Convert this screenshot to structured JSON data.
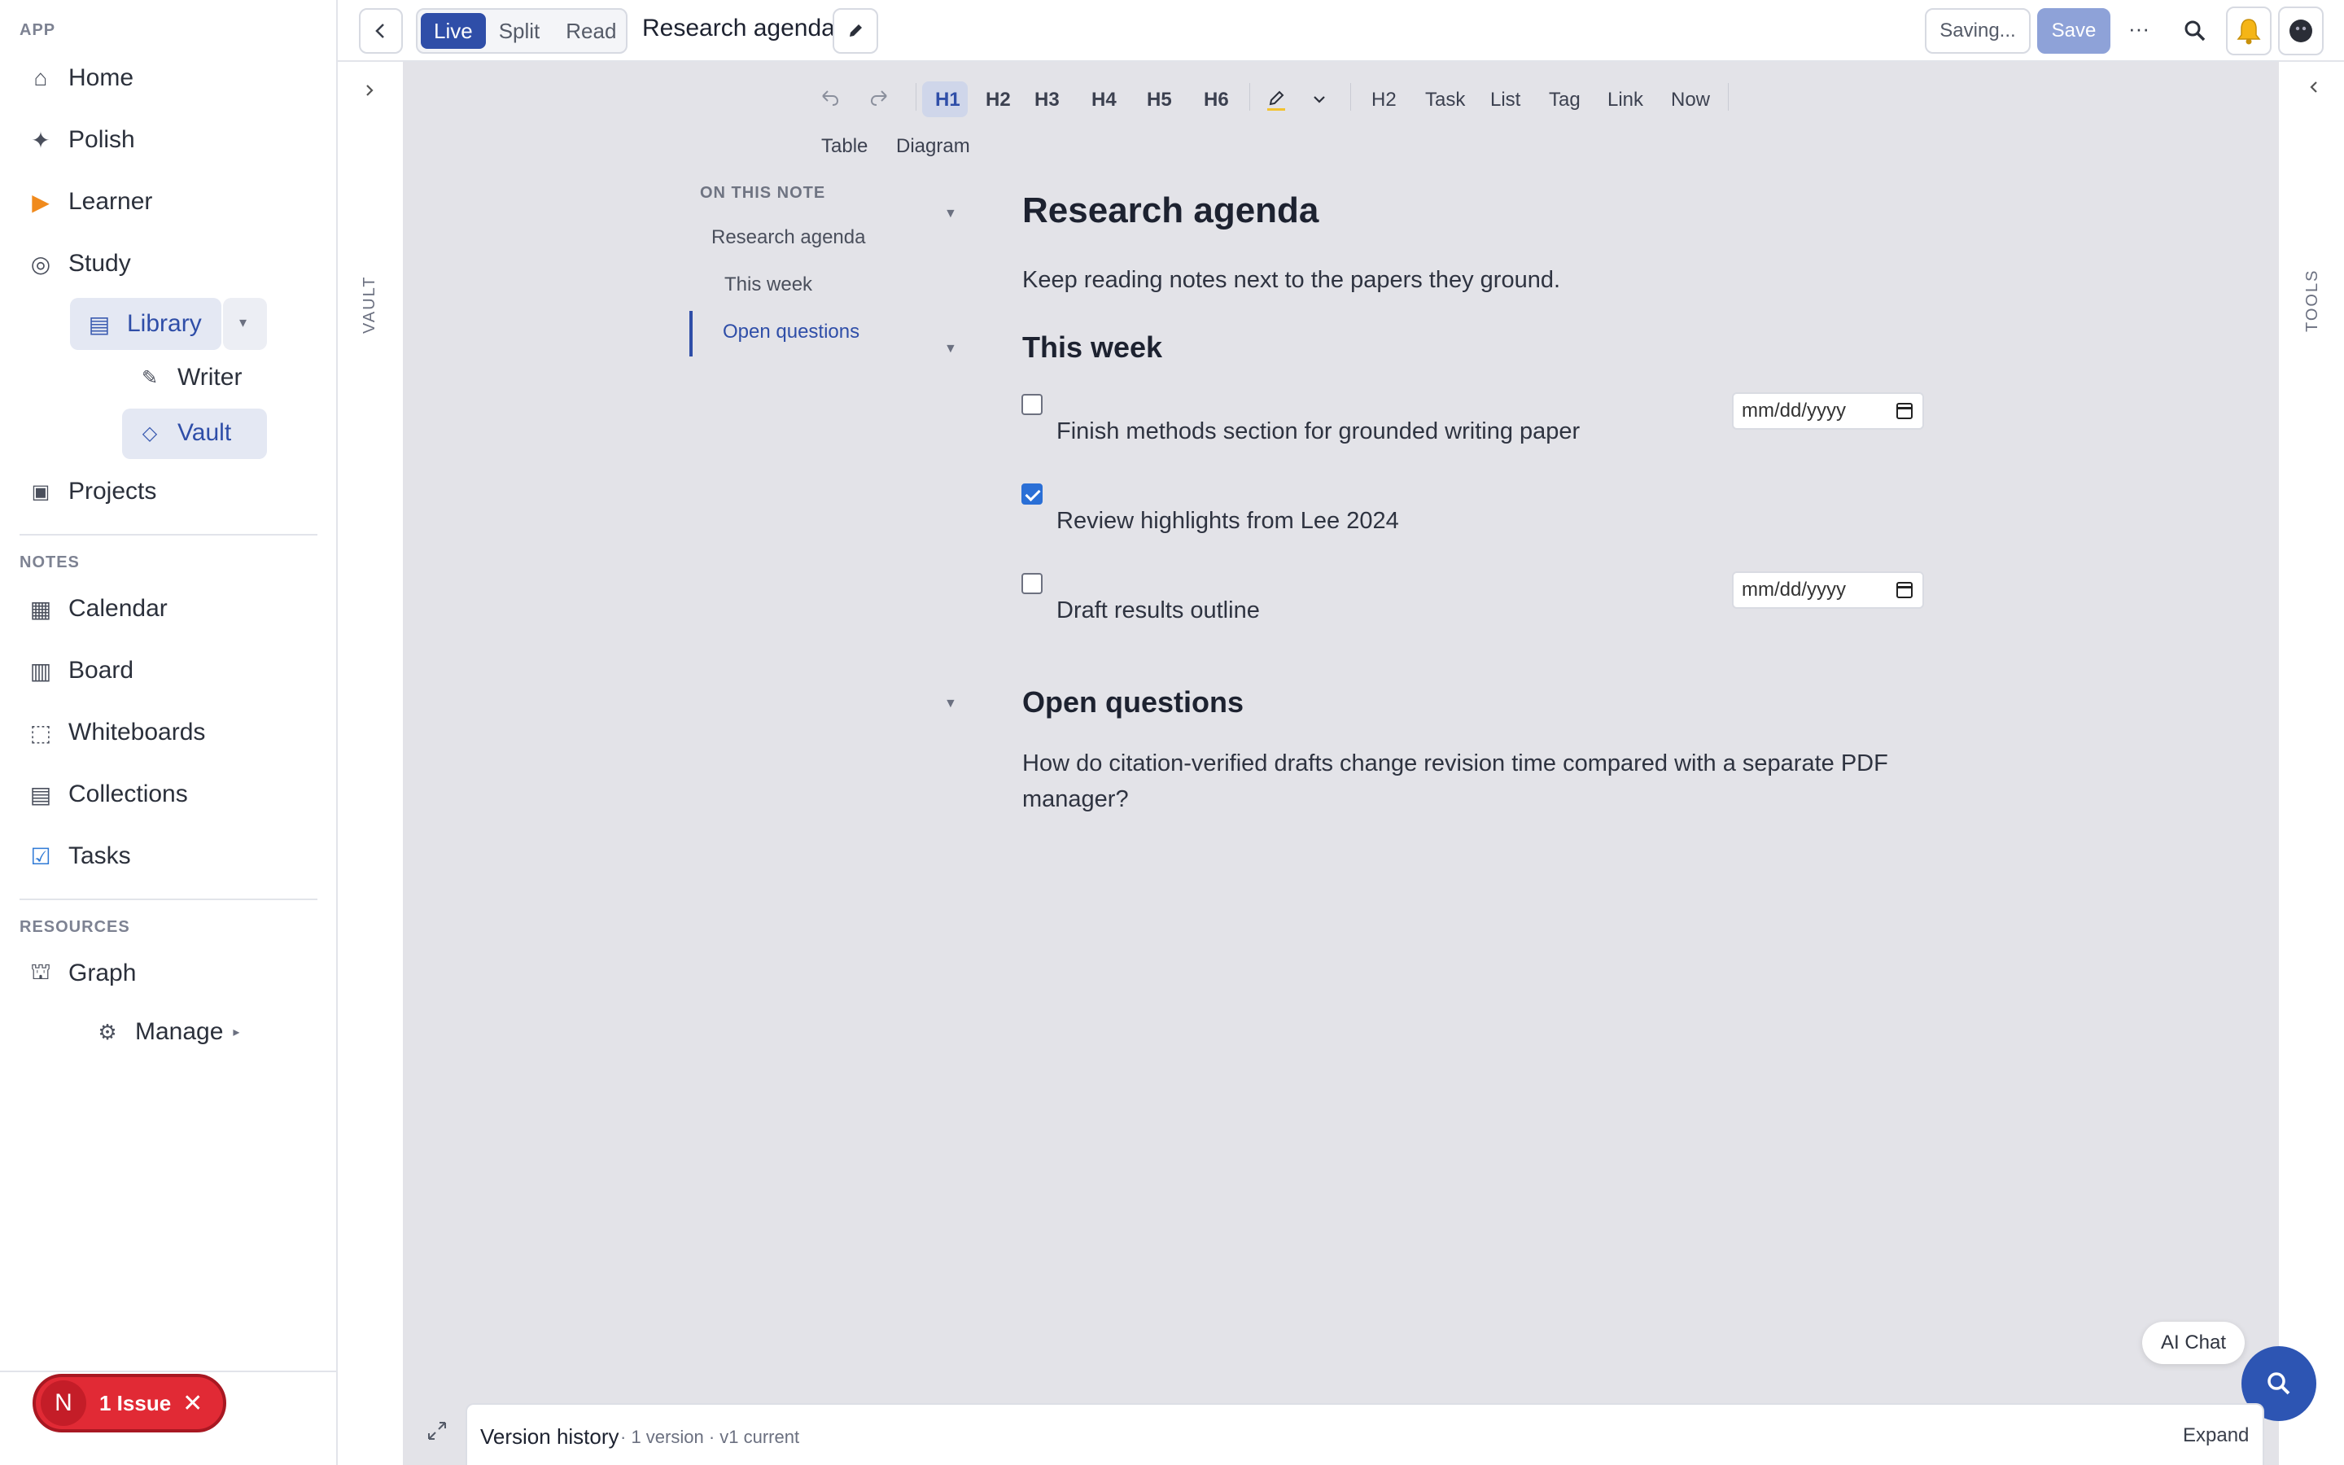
{
  "sidebar": {
    "app_title": "APP",
    "app_items": [
      {
        "icon": "home-icon",
        "glyph": "⌂",
        "label": "Home"
      },
      {
        "icon": "sparkle-icon",
        "glyph": "✦",
        "label": "Polish"
      },
      {
        "icon": "play-icon",
        "glyph": "▶",
        "label": "Learner"
      },
      {
        "icon": "target-icon",
        "glyph": "◎",
        "label": "Study"
      }
    ],
    "study_sub": {
      "library": {
        "icon": "library-icon",
        "glyph": "▤",
        "label": "Library",
        "caret": "▾"
      },
      "writer": {
        "icon": "pen-icon",
        "glyph": "✎",
        "label": "Writer"
      },
      "vault": {
        "icon": "diamond-icon",
        "glyph": "◇",
        "label": "Vault"
      }
    },
    "projects": {
      "icon": "projects-icon",
      "glyph": "▣",
      "label": "Projects"
    },
    "notes_title": "NOTES",
    "notes_items": [
      {
        "icon": "calendar-icon",
        "glyph": "▦",
        "label": "Calendar"
      },
      {
        "icon": "board-icon",
        "glyph": "▥",
        "label": "Board"
      },
      {
        "icon": "whiteboard-icon",
        "glyph": "⬚",
        "label": "Whiteboards"
      },
      {
        "icon": "collections-icon",
        "glyph": "▤",
        "label": "Collections"
      },
      {
        "icon": "tasks-icon",
        "glyph": "☑",
        "label": "Tasks"
      }
    ],
    "resources_title": "RESOURCES",
    "graph": {
      "icon": "graph-icon",
      "glyph": "⛫",
      "label": "Graph"
    },
    "manage": {
      "icon": "gear-icon",
      "glyph": "⚙",
      "label": "Manage",
      "caret": "▸"
    }
  },
  "topbar": {
    "modes": [
      "Live",
      "Split",
      "Read"
    ],
    "active_mode": "Live",
    "note_title": "Research agenda",
    "status": "Saving...",
    "save_label": "Save",
    "more_label": "···"
  },
  "gutters": {
    "left_label": "VAULT",
    "right_label": "TOOLS"
  },
  "toolbar": {
    "headings": [
      "H1",
      "H2",
      "H3",
      "H4",
      "H5",
      "H6"
    ],
    "inserts": [
      "H2",
      "Task",
      "List",
      "Tag",
      "Link",
      "Now"
    ],
    "row2": [
      "Table",
      "Diagram"
    ]
  },
  "toc": {
    "title": "ON THIS NOTE",
    "items": [
      "Research agenda",
      "This week",
      "Open questions"
    ]
  },
  "note": {
    "title": "Research agenda",
    "intro": "Keep reading notes next to the papers they ground.",
    "section1": "This week",
    "tasks": [
      {
        "text": "Finish methods section for grounded writing paper",
        "checked": false,
        "date_placeholder": "mm/dd/yyyy"
      },
      {
        "text": "Review highlights from Lee 2024",
        "checked": true
      },
      {
        "text": "Draft results outline",
        "checked": false,
        "date_placeholder": "mm/dd/yyyy"
      }
    ],
    "section2": "Open questions",
    "question_line1": "How do citation-verified drafts change revision time compared with a separate PDF",
    "question_line2": "manager?"
  },
  "bottom": {
    "version_label": "Version history",
    "version_meta": "· 1 version · v1 current",
    "expand_label": "Expand",
    "ai_chat": "AI Chat",
    "issue_count_label": "1 Issue",
    "issue_avatar": "N"
  },
  "colors": {
    "accent": "#2f4ea8",
    "canvas_bg": "#e3e3e8",
    "issue_red": "#e12a35"
  }
}
